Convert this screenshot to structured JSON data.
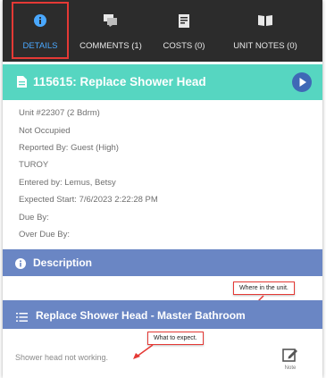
{
  "tabs": [
    {
      "label": "DETAILS",
      "icon": "info-icon",
      "active": true
    },
    {
      "label": "COMMENTS (1)",
      "icon": "comments-icon",
      "active": false
    },
    {
      "label": "COSTS (0)",
      "icon": "receipt-icon",
      "active": false
    },
    {
      "label": "UNIT NOTES (0)",
      "icon": "book-icon",
      "active": false
    }
  ],
  "header": {
    "title": "115615: Replace Shower Head"
  },
  "details": [
    "Unit #22307 (2 Bdrm)",
    "Not Occupied",
    "Reported By: Guest  (High)",
    "TUROY",
    "Entered by: Lemus, Betsy",
    "Expected Start: 7/6/2023 2:22:28 PM",
    "Due By:",
    "Over Due By:"
  ],
  "description_bar": {
    "label": "Description"
  },
  "task_bar": {
    "label": "Replace Shower Head - Master Bathroom"
  },
  "notes_text": "Shower head not working.",
  "note_button": {
    "label": "Note"
  },
  "callouts": {
    "where": "Where in the unit.",
    "what": "What to expect."
  },
  "colors": {
    "tabbar": "#2c2c2c",
    "active_tab": "#4aa8ff",
    "header": "#56d6c1",
    "bar": "#6a86c4",
    "play": "#3f68b6",
    "callout_border": "#e53935"
  }
}
